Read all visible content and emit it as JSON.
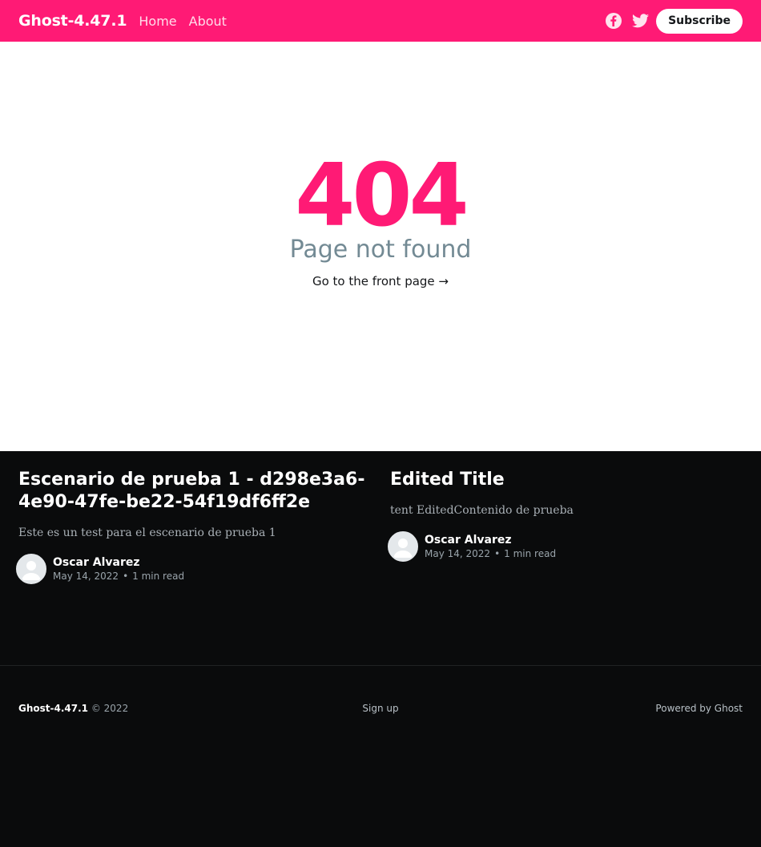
{
  "header": {
    "site_title": "Ghost-4.47.1",
    "nav": [
      {
        "label": "Home"
      },
      {
        "label": "About"
      }
    ],
    "subscribe_label": "Subscribe",
    "social_icons": [
      "facebook-icon",
      "twitter-icon"
    ],
    "accent_color": "#ff1a75"
  },
  "error": {
    "code": "404",
    "description": "Page not found",
    "link_text": "Go to the front page →"
  },
  "posts": [
    {
      "title": "Escenario de prueba 1 - d298e3a6-4e90-47fe-be22-54f19df6ff2e",
      "excerpt": "Este es un test para el escenario de prueba 1",
      "author": "Oscar Alvarez",
      "date": "May 14, 2022",
      "read_time": "1 min read"
    },
    {
      "title": "Edited Title",
      "excerpt": "tent EditedContenido de prueba",
      "author": "Oscar Alvarez",
      "date": "May 14, 2022",
      "read_time": "1 min read"
    }
  ],
  "footer": {
    "site_name": "Ghost-4.47.1",
    "copyright": "© 2022",
    "signup": "Sign up",
    "powered": "Powered by Ghost"
  }
}
